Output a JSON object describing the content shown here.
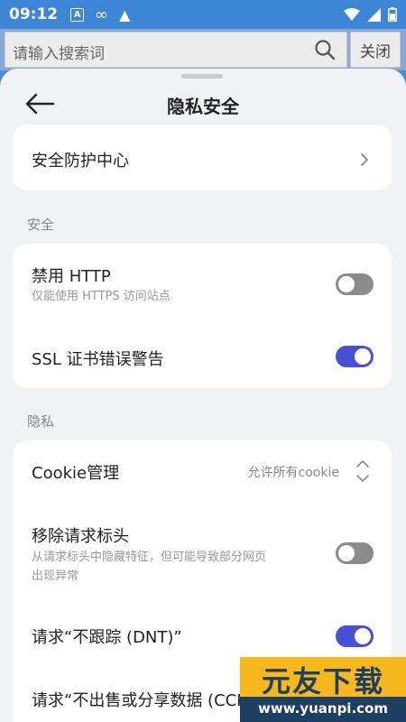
{
  "status_bar": {
    "time": "09:12",
    "icons": [
      "a-notification-icon",
      "infinity-icon",
      "warning-icon",
      "wifi-icon",
      "signal-icon",
      "battery-icon"
    ],
    "a_glyph": "A",
    "infinity_glyph": "∞",
    "warning_glyph": "▲"
  },
  "search": {
    "placeholder": "请输入搜索词",
    "close_label": "关闭"
  },
  "header": {
    "title": "隐私安全"
  },
  "top_card": {
    "item_label": "安全防护中心"
  },
  "security_section": {
    "label": "安全",
    "items": [
      {
        "title": "禁用 HTTP",
        "subtitle": "仅能使用 HTTPS 访问站点",
        "enabled": false
      },
      {
        "title": "SSL 证书错误警告",
        "enabled": true
      }
    ]
  },
  "privacy_section": {
    "label": "隐私",
    "cookie": {
      "title": "Cookie管理",
      "value": "允许所有cookie"
    },
    "items": [
      {
        "title": "移除请求标头",
        "subtitle_line1": "从请求标头中隐藏特征，但可能导致部分网页",
        "subtitle_line2": "出现异常",
        "enabled": false
      },
      {
        "title": "请求“不跟踪 (DNT)”",
        "enabled": true
      },
      {
        "title": "请求“不出售或分享数据 (CCPA",
        "enabled": true
      }
    ]
  },
  "watermark": {
    "logo": "元友下载",
    "url": "www.yuanpi.com"
  },
  "colors": {
    "status_bar": "#3d86d6",
    "toggle_on": "#4950d8",
    "toggle_off": "#8c8c8c",
    "sheet_bg": "#f1f2f4"
  }
}
